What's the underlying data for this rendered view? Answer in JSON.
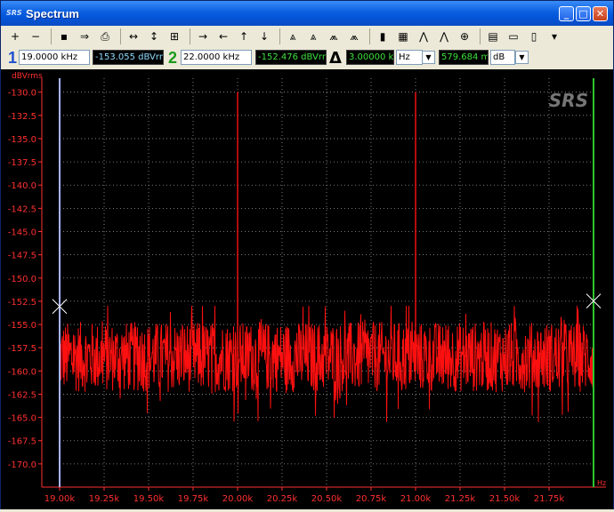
{
  "window": {
    "title": "Spectrum",
    "app_logo": "SRS",
    "buttons": {
      "minimize": "_",
      "maximize": "□",
      "close": "✕"
    }
  },
  "toolbar": {
    "tools": [
      {
        "name": "zoom-in-icon",
        "glyph": "+"
      },
      {
        "name": "zoom-out-icon",
        "glyph": "−"
      },
      {
        "name": "save-icon",
        "glyph": "▪"
      },
      {
        "name": "export-icon",
        "glyph": "⇒"
      },
      {
        "name": "print-icon",
        "glyph": "⎙"
      },
      {
        "name": "fit-horizontal-icon",
        "glyph": "↔"
      },
      {
        "name": "fit-vertical-icon",
        "glyph": "↕"
      },
      {
        "name": "fit-all-icon",
        "glyph": "⊞"
      },
      {
        "name": "arrow-right-icon",
        "glyph": "→"
      },
      {
        "name": "arrow-left-icon",
        "glyph": "←"
      },
      {
        "name": "arrow-up-icon",
        "glyph": "↑"
      },
      {
        "name": "arrow-down-icon",
        "glyph": "↓"
      },
      {
        "name": "marker-peak-icon",
        "glyph": "⩓"
      },
      {
        "name": "marker-next-peak-icon",
        "glyph": "⩓"
      },
      {
        "name": "marker-left-peak-icon",
        "glyph": "⩕"
      },
      {
        "name": "marker-right-peak-icon",
        "glyph": "⩕"
      },
      {
        "name": "bars-icon",
        "glyph": "▮"
      },
      {
        "name": "log-scale-icon",
        "glyph": "▦"
      },
      {
        "name": "harmonic-icon",
        "glyph": "⋀"
      },
      {
        "name": "harmonic-alt-icon",
        "glyph": "⋀"
      },
      {
        "name": "crosshair-icon",
        "glyph": "⊕"
      },
      {
        "name": "properties-icon",
        "glyph": "▤"
      },
      {
        "name": "table-icon",
        "glyph": "▭"
      },
      {
        "name": "calculator-icon",
        "glyph": "▯"
      },
      {
        "name": "menu-arrow-icon",
        "glyph": "▾"
      }
    ]
  },
  "markers": {
    "m1": {
      "label": "1",
      "freq": "19.0000 kHz",
      "level": "-153.055 dBVrm"
    },
    "m2": {
      "label": "2",
      "freq": "22.0000 kHz",
      "level": "-152.476 dBVrm"
    },
    "delta": {
      "symbol": "Δ",
      "freq": "3.00000 k",
      "freq_unit": "Hz",
      "level": "579.684 m",
      "level_unit": "dB"
    }
  },
  "chart_data": {
    "type": "line",
    "ylabel": "dBVrms",
    "xlabel": "Hz",
    "xlim": [
      19000,
      22000
    ],
    "ylim": [
      -172.5,
      -128.5
    ],
    "xticks": [
      19000,
      19250,
      19500,
      19750,
      20000,
      20250,
      20500,
      20750,
      21000,
      21250,
      21500,
      21750
    ],
    "xtick_labels": [
      "19.00k",
      "19.25k",
      "19.50k",
      "19.75k",
      "20.00k",
      "20.25k",
      "20.50k",
      "20.75k",
      "21.00k",
      "21.25k",
      "21.50k",
      "21.75k"
    ],
    "yticks": [
      -130,
      -132.5,
      -135,
      -137.5,
      -140,
      -142.5,
      -145,
      -147.5,
      -150,
      -152.5,
      -155,
      -157.5,
      -160,
      -162.5,
      -165,
      -167.5,
      -170
    ],
    "ytick_labels": [
      "-130.0",
      "-132.5",
      "-135.0",
      "-137.5",
      "-140.0",
      "-142.5",
      "-145.0",
      "-147.5",
      "-150.0",
      "-152.5",
      "-155.0",
      "-157.5",
      "-160.0",
      "-162.5",
      "-165.0",
      "-167.5",
      "-170.0"
    ],
    "noise_floor": {
      "mean": -158.5,
      "band": [
        -163.5,
        -154
      ]
    },
    "peaks": [
      {
        "x": 20000,
        "y": -130
      },
      {
        "x": 21000,
        "y": -130
      }
    ],
    "cursor1": {
      "x": 19000,
      "y": -153.055
    },
    "cursor2": {
      "x": 22000,
      "y": -152.476
    },
    "grid": true,
    "watermark": "SRS",
    "colors": {
      "trace": "#ff1010",
      "axis_text": "#ff3030",
      "grid": "#9a9a9a",
      "cursor1": "#a8b4ff",
      "cursor2": "#2ec52e",
      "background": "#000000"
    }
  }
}
